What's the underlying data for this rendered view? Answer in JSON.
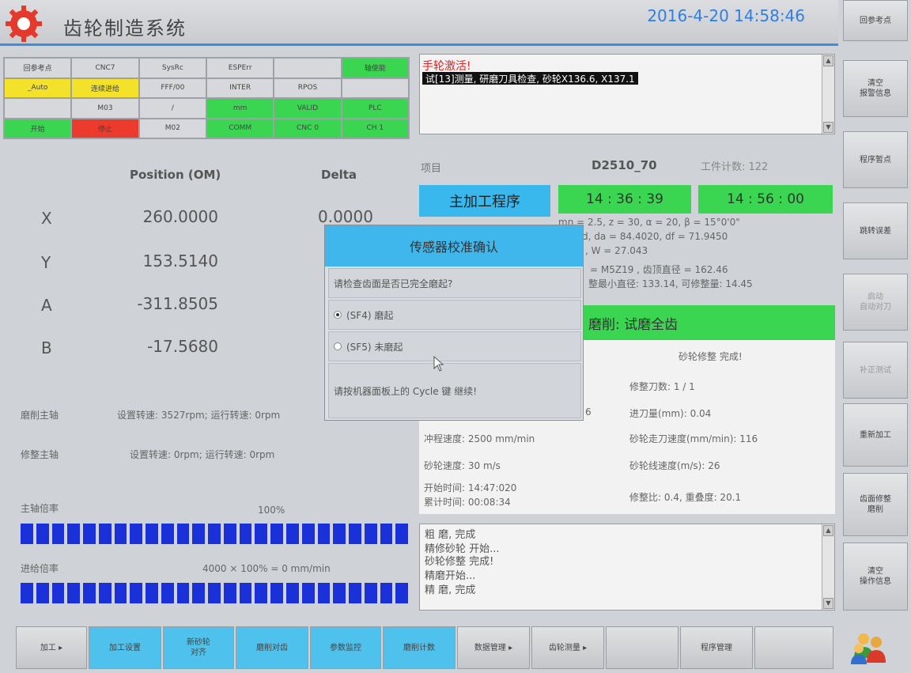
{
  "header": {
    "app_title": "齿轮制造系统",
    "datetime": "2016-4-20 14:58:46"
  },
  "status_grid": [
    {
      "text": "回参考点",
      "style": "plain"
    },
    {
      "text": "CNC7",
      "style": "plain"
    },
    {
      "text": "SysRc",
      "style": "plain"
    },
    {
      "text": "ESPErr",
      "style": "plain"
    },
    {
      "text": "",
      "style": "plain"
    },
    {
      "text": "轴使能",
      "style": "green"
    },
    {
      "text": "_Auto",
      "style": "yellow"
    },
    {
      "text": "连续进给",
      "style": "yellow"
    },
    {
      "text": "FFF/00",
      "style": "plain"
    },
    {
      "text": "INTER",
      "style": "plain"
    },
    {
      "text": "RPOS",
      "style": "plain"
    },
    {
      "text": "",
      "style": "plain"
    },
    {
      "text": "",
      "style": "plain"
    },
    {
      "text": "M03",
      "style": "plain"
    },
    {
      "text": "/",
      "style": "plain"
    },
    {
      "text": "mm",
      "style": "green"
    },
    {
      "text": "VALID",
      "style": "green"
    },
    {
      "text": "PLC",
      "style": "green"
    },
    {
      "text": "开始",
      "style": "green"
    },
    {
      "text": "停止",
      "style": "red"
    },
    {
      "text": "M02",
      "style": "plain"
    },
    {
      "text": "COMM",
      "style": "green"
    },
    {
      "text": "CNC 0",
      "style": "green"
    },
    {
      "text": "CH 1",
      "style": "green"
    }
  ],
  "message": {
    "title": "手轮激活!",
    "line": "试[13]测量, 研磨刀具检查, 砂轮X136.6, X137.1"
  },
  "position": {
    "header": "Position (OM)",
    "delta_header": "Delta",
    "axes": [
      {
        "name": "X",
        "value": "260.0000"
      },
      {
        "name": "Y",
        "value": "153.5140"
      },
      {
        "name": "A",
        "value": "-311.8505"
      },
      {
        "name": "B",
        "value": "-17.5680"
      }
    ],
    "delta_x": "0.0000"
  },
  "spindles": [
    {
      "label": "磨削主轴",
      "info": "设置转速: 3527rpm; 运行转速: 0rpm"
    },
    {
      "label": "修整主轴",
      "info": "设置转速: 0rpm; 运行转速: 0rpm"
    }
  ],
  "spindle_override": {
    "label": "主轴倍率",
    "percent": "100%"
  },
  "feed_override": {
    "label": "进给倍率",
    "formula": "4000 × 100% = 0 mm/min"
  },
  "program": {
    "item_label": "项目",
    "name": "D2510_70",
    "piece_count": "工件计数: 122",
    "main_button": "主加工程序",
    "time_start": "14 : 36 : 39",
    "time_end": "14 : 56 : 00",
    "info_lines": [
      "mn = 2.5, z = 30, α = 20, β = 15°0'0\"",
      "d, da = 84.4020, df = 71.9450",
      ", W = 27.043",
      "= M5Z19 , 齿顶直径 = 162.46",
      "整最小直径: 133.14, 可修整量: 14.45"
    ]
  },
  "grinding": {
    "banner": "磨削: 试磨全齿",
    "status": "砂轮修整 完成!",
    "left_items": [
      "冲程速度: 2500 mm/min",
      "砂轮速度: 30 m/s",
      "开始时间: 14:47:020",
      "累计时间: 00:08:34"
    ],
    "right_items": [
      "修整刀数: 1 / 1",
      "进刀量(mm): 0.04",
      "砂轮走刀速度(mm/min): 116",
      "砂轮线速度(m/s): 26",
      "修整比: 0.4, 重叠度: 20.1"
    ],
    "partial": "6"
  },
  "log": [
    "粗    磨, 完成",
    "精修砂轮 开始...",
    "砂轮修整  完成!",
    "精磨开始...",
    "精    磨, 完成"
  ],
  "dialog": {
    "title": "传感器校准确认",
    "question": "请检查齿面是否已完全磨起?",
    "option1": "(SF4) 磨起",
    "option2": "(SF5) 未磨起",
    "hint": "请按机器面板上的 Cycle 键 继续!"
  },
  "right_buttons": [
    {
      "label": "回参考点",
      "enabled": true
    },
    {
      "label": "清空\n报警信息",
      "enabled": true
    },
    {
      "label": "程序暂点",
      "enabled": true
    },
    {
      "label": "跳转误差",
      "enabled": true
    },
    {
      "label": "启动\n自动对刀",
      "enabled": false
    },
    {
      "label": "补正测试",
      "enabled": false
    },
    {
      "label": "重新加工",
      "enabled": true
    },
    {
      "label": "齿面修整\n磨削",
      "enabled": true
    },
    {
      "label": "清空\n操作信息",
      "enabled": true
    }
  ],
  "bottom_buttons": [
    {
      "label": "加工 ▸",
      "style": "plain"
    },
    {
      "label": "加工设置",
      "style": "blue"
    },
    {
      "label": "新砂轮\n对齐",
      "style": "blue"
    },
    {
      "label": "磨削对齿",
      "style": "blue"
    },
    {
      "label": "参数监控",
      "style": "blue"
    },
    {
      "label": "磨削计数",
      "style": "blue"
    },
    {
      "label": "数据管理 ▸",
      "style": "plain"
    },
    {
      "label": "齿轮测量 ▸",
      "style": "plain"
    },
    {
      "label": "",
      "style": "plain"
    },
    {
      "label": "程序管理",
      "style": "plain"
    },
    {
      "label": "",
      "style": "plain"
    }
  ],
  "colors": {
    "accent_blue": "#39b8ee",
    "status_green": "#3bd651",
    "status_yellow": "#f3e12a",
    "status_red": "#ec3a2c",
    "bar_blue": "#1a30d8",
    "datetime_blue": "#2f7fe0"
  },
  "icons": [
    "gear-logo-icon",
    "users-icon",
    "radio-icon",
    "scroll-arrow-icon",
    "pointer-cursor-icon"
  ]
}
